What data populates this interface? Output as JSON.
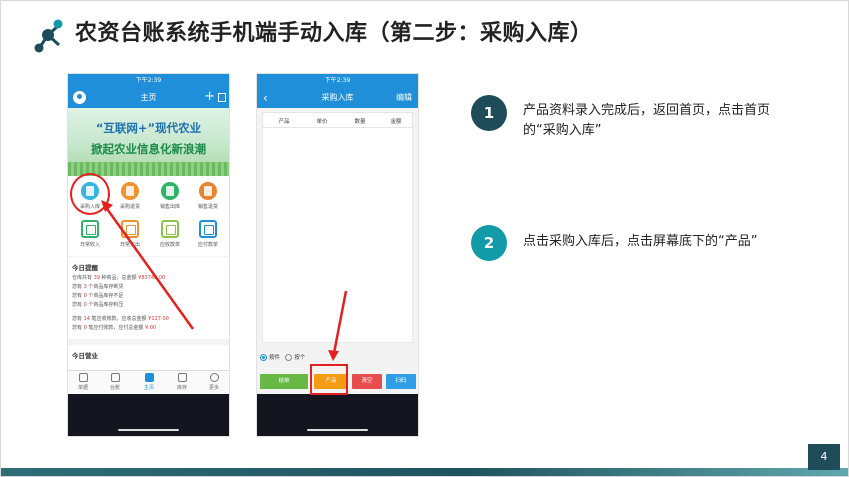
{
  "slide": {
    "title": "农资台账系统手机端手动入库（第二步：采购入库）",
    "page_number": "4"
  },
  "phone1": {
    "status_time": "下午2:39",
    "nav_title": "主页",
    "banner": {
      "line1": "“互联网+”现代农业",
      "line2": "掀起农业信息化新浪潮"
    },
    "grid": [
      {
        "label": "采购入库",
        "color": "#36b5e0"
      },
      {
        "label": "采购退货",
        "color": "#f0922e"
      },
      {
        "label": "销售出库",
        "color": "#2fb36a"
      },
      {
        "label": "销售退货",
        "color": "#e8842e"
      },
      {
        "label": "日常收入",
        "color": "#2fb36a"
      },
      {
        "label": "日常支出",
        "color": "#f0922e"
      },
      {
        "label": "应收款单",
        "color": "#8bc34a"
      },
      {
        "label": "应付款单",
        "color": "#1e8fd8"
      }
    ],
    "today": {
      "title": "今日提醒",
      "lines": [
        [
          "仓库共有 ",
          "39",
          " 种商品，总金额 ",
          "¥83742.00"
        ],
        [
          "您有 ",
          "3",
          " 个商品库存断货",
          ""
        ],
        [
          "您有 ",
          "0",
          " 个商品库存不足",
          ""
        ],
        [
          "您有 ",
          "0",
          " 个商品库存积压",
          ""
        ],
        [
          "您有 ",
          "14",
          " 笔应收账款，应收总金额 ",
          "¥127.00"
        ],
        [
          "您有 ",
          "0",
          " 笔应付账款，应付总金额 ",
          "¥.00"
        ]
      ]
    },
    "ops_title": "今日营业",
    "tabs": [
      "单据",
      "台账",
      "主页",
      "库存",
      "更多"
    ]
  },
  "phone2": {
    "status_time": "下午2:39",
    "nav_title": "采购入库",
    "edit_label": "编辑",
    "columns": [
      "产品",
      "单价",
      "数量",
      "金额"
    ],
    "radio_options": [
      "按件",
      "按个"
    ],
    "actions": [
      {
        "label": "结单",
        "color": "#67b845"
      },
      {
        "label": "产品",
        "color": "#f39c12"
      },
      {
        "label": "清空",
        "color": "#e84d4d"
      },
      {
        "label": "扫码",
        "color": "#2f9ee8"
      }
    ]
  },
  "steps": [
    {
      "number": "1",
      "text": "产品资料录入完成后，返回首页，点击首页的“采购入库”"
    },
    {
      "number": "2",
      "text": "点击采购入库后，点击屏幕底下的“产品”"
    }
  ]
}
